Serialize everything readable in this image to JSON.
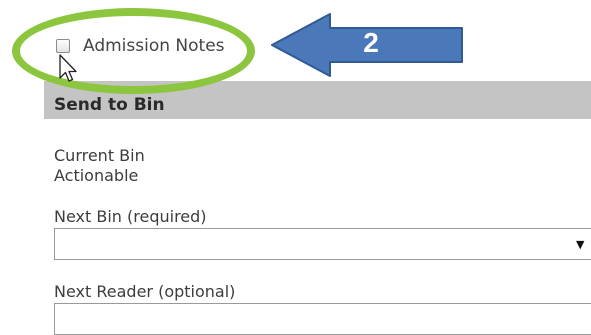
{
  "admission_notes": {
    "label": "Admission Notes",
    "checked": false
  },
  "annotation": {
    "step_number": "2",
    "arrow_color": "#4a78b8",
    "ring_color": "#8cc63e"
  },
  "panel": {
    "header": "Send to Bin"
  },
  "current_bin": {
    "label": "Current Bin",
    "value": "Actionable"
  },
  "next_bin": {
    "label": "Next Bin (required)",
    "selected": ""
  },
  "next_reader": {
    "label": "Next Reader (optional)",
    "value": ""
  }
}
